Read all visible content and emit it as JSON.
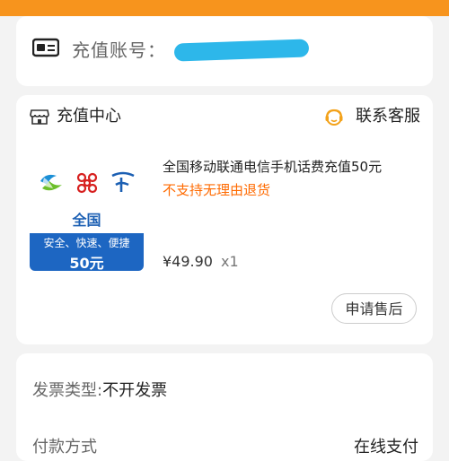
{
  "account": {
    "label": "充值账号："
  },
  "center": {
    "title": "充值中心",
    "service_label": "联系客服"
  },
  "product": {
    "image": {
      "region": "全国",
      "slogan": "安全、快速、便捷",
      "amount": "50元"
    },
    "title": "全国移动联通电信手机话费充值50元",
    "note": "不支持无理由退货",
    "price": "¥49.90",
    "quantity": "x1",
    "after_sale_button": "申请售后"
  },
  "invoice": {
    "label": "发票类型:",
    "value": "不开发票"
  },
  "payment": {
    "label": "付款方式",
    "value": "在线支付"
  },
  "colors": {
    "brand_orange": "#f7941d",
    "note_orange": "#ff6a00",
    "mask_blue": "#2db7ea",
    "badge_blue": "#1d66c2"
  }
}
